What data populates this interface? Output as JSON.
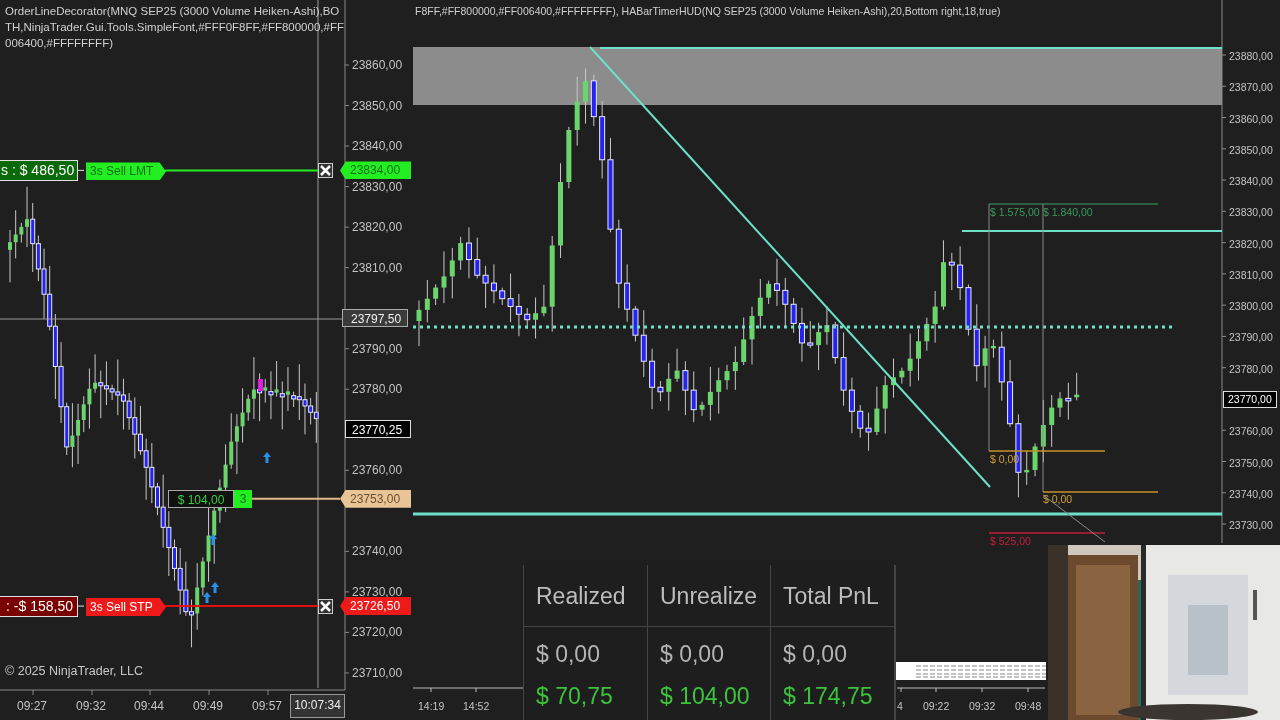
{
  "left_chart": {
    "indicator_label": "OrderLineDecorator(MNQ SEP25 (3000 Volume Heiken-Ashi),BOTH,NinjaTrader.Gui.Tools.SimpleFont,#FFF0F8FF,#FF800000,#FF006400,#FFFFFFFF)",
    "price_axis": [
      "23860,00",
      "23850,00",
      "23840,00",
      "23830,00",
      "23820,00",
      "23810,00",
      "23790,00",
      "23780,00",
      "23760,00",
      "23740,00",
      "23730,00",
      "23720,00",
      "23710,00"
    ],
    "order_lines": [
      {
        "kind": "limit",
        "pnl": "s : $ 486,50",
        "label": "3s  Sell LMT",
        "price": "23834,00"
      },
      {
        "kind": "stop",
        "pnl": ": -$ 158,50",
        "label": "3s  Sell STP",
        "price": "23726,50"
      }
    ],
    "position": {
      "pnl": "$ 104,00",
      "quantity": "3",
      "price": "23753,00"
    },
    "crosshair_price": "23797,50",
    "last_price": "23770,25",
    "copyright": "© 2025 NinjaTrader, LLC",
    "time_axis": [
      "09:27",
      "09:32",
      "09:44",
      "09:49",
      "09:57"
    ],
    "current_time": "10:07:34"
  },
  "right_chart": {
    "indicator_label": "F8FF,#FF800000,#FF006400,#FFFFFFFF), HABarTimerHUD(NQ SEP25 (3000 Volume Heiken-Ashi),20,Bottom right,18,true)",
    "price_axis": [
      "23880,00",
      "23870,00",
      "23860,00",
      "23850,00",
      "23840,00",
      "23830,00",
      "23820,00",
      "23810,00",
      "23800,00",
      "23790,00",
      "23780,00",
      "23760,00",
      "23750,00",
      "23740,00",
      "23730,00"
    ],
    "last_price": "23770,00",
    "trade_labels": [
      {
        "kind": "target",
        "text": "$ 1.575,00"
      },
      {
        "kind": "target",
        "text": "$ 1.840,00"
      },
      {
        "kind": "entry",
        "text": "$ 0,00"
      },
      {
        "kind": "entry",
        "text": "$ 0,00"
      },
      {
        "kind": "stop",
        "text": "$ 525,00"
      }
    ],
    "time_axis": [
      "14:19",
      "14:52",
      "4",
      "09:22",
      "09:32",
      "09:48"
    ]
  },
  "pnl_table": {
    "columns": [
      "Realized",
      "Unrealize",
      "Total PnL"
    ],
    "rows": [
      {
        "color": "#b4b4b4",
        "cells": [
          "$ 0,00",
          "$ 0,00",
          "$ 0,00"
        ]
      },
      {
        "color": "#3cc43c",
        "cells": [
          "$ 70,75",
          "$ 104,00",
          "$ 174,75"
        ]
      }
    ]
  }
}
